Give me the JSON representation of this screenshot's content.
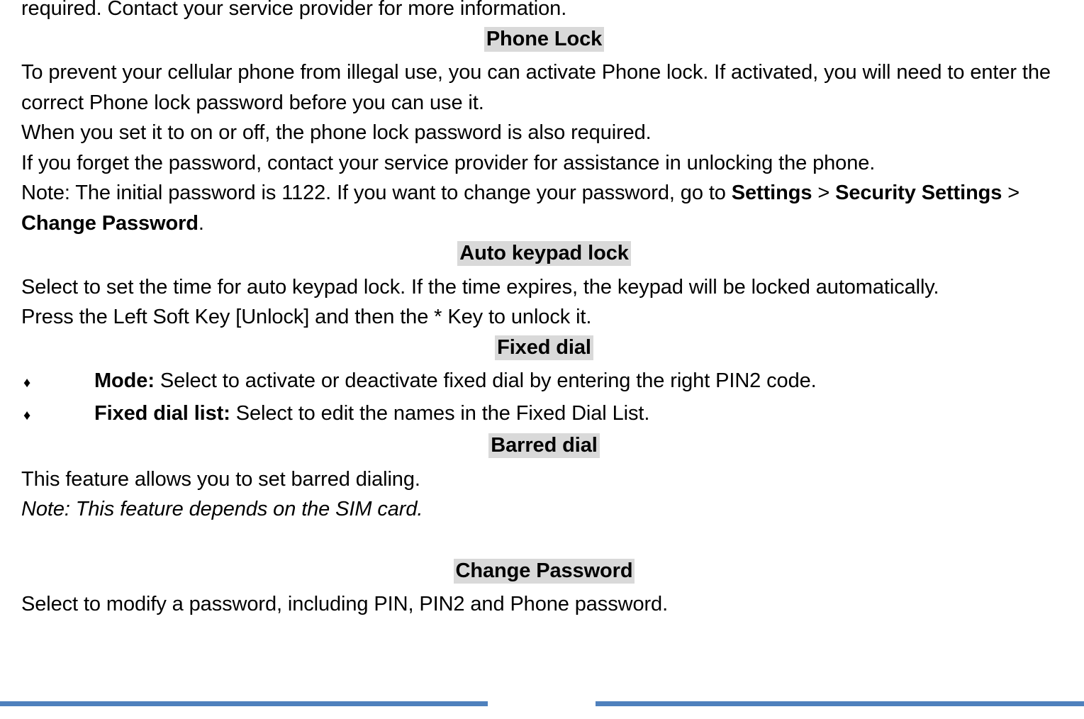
{
  "document": {
    "type": "user-manual-page",
    "highlight_color": "#D9D9D9",
    "footer_rule_color": "#4F81BD",
    "bullet_glyph": "♦",
    "intro": {
      "continued_line": "required. Contact your service provider for more information."
    },
    "sections": [
      {
        "heading": "Phone Lock",
        "lines": [
          {
            "kind": "wrap",
            "runs": [
              {
                "text": "To prevent your cellular phone from illegal use, you can activate Phone lock. If activated, you will need to enter the correct Phone lock password before you can use it.",
                "style": "normal"
              }
            ]
          },
          {
            "kind": "line",
            "runs": [
              {
                "text": "When you set it to on or off, the phone lock password is also required.",
                "style": "normal"
              }
            ]
          },
          {
            "kind": "line",
            "runs": [
              {
                "text": "If you forget the password, contact your service provider for assistance in unlocking the phone.",
                "style": "normal"
              }
            ]
          },
          {
            "kind": "wrap",
            "runs": [
              {
                "text": "Note: The initial password is 1122. If you want to change your password, go to ",
                "style": "normal"
              },
              {
                "text": "Settings",
                "style": "bold"
              },
              {
                "text": " > ",
                "style": "normal"
              },
              {
                "text": "Security Settings",
                "style": "bold"
              },
              {
                "text": " > ",
                "style": "normal"
              },
              {
                "text": "Change Password",
                "style": "bold"
              },
              {
                "text": ".",
                "style": "normal"
              }
            ]
          }
        ]
      },
      {
        "heading": "Auto keypad lock",
        "lines": [
          {
            "kind": "line",
            "runs": [
              {
                "text": "Select to set the time for auto keypad lock. If the time expires, the keypad will be locked automatically.",
                "style": "normal"
              }
            ]
          },
          {
            "kind": "line",
            "runs": [
              {
                "text": "Press the Left Soft Key [Unlock] and then the * Key to unlock it.",
                "style": "normal"
              }
            ]
          }
        ]
      },
      {
        "heading": "Fixed dial",
        "bullets": [
          {
            "marker": "♦",
            "runs": [
              {
                "text": "Mode:",
                "style": "bold"
              },
              {
                "text": " Select to activate or deactivate fixed dial by entering the right PIN2 code.",
                "style": "normal"
              }
            ]
          },
          {
            "marker": "♦",
            "runs": [
              {
                "text": "Fixed dial list:",
                "style": "bold"
              },
              {
                "text": " Select to edit the names in the Fixed Dial List.",
                "style": "normal"
              }
            ]
          }
        ]
      },
      {
        "heading": "Barred dial",
        "lines": [
          {
            "kind": "line",
            "runs": [
              {
                "text": "This feature allows you to set barred dialing.",
                "style": "normal"
              }
            ]
          },
          {
            "kind": "line",
            "runs": [
              {
                "text": "Note: This feature depends on the SIM card.",
                "style": "italic"
              }
            ]
          }
        ]
      },
      {
        "heading": "Change Password",
        "lines": [
          {
            "kind": "line",
            "runs": [
              {
                "text": "Select to modify a password, including PIN, PIN2 and Phone password.",
                "style": "normal"
              }
            ]
          }
        ]
      }
    ]
  }
}
